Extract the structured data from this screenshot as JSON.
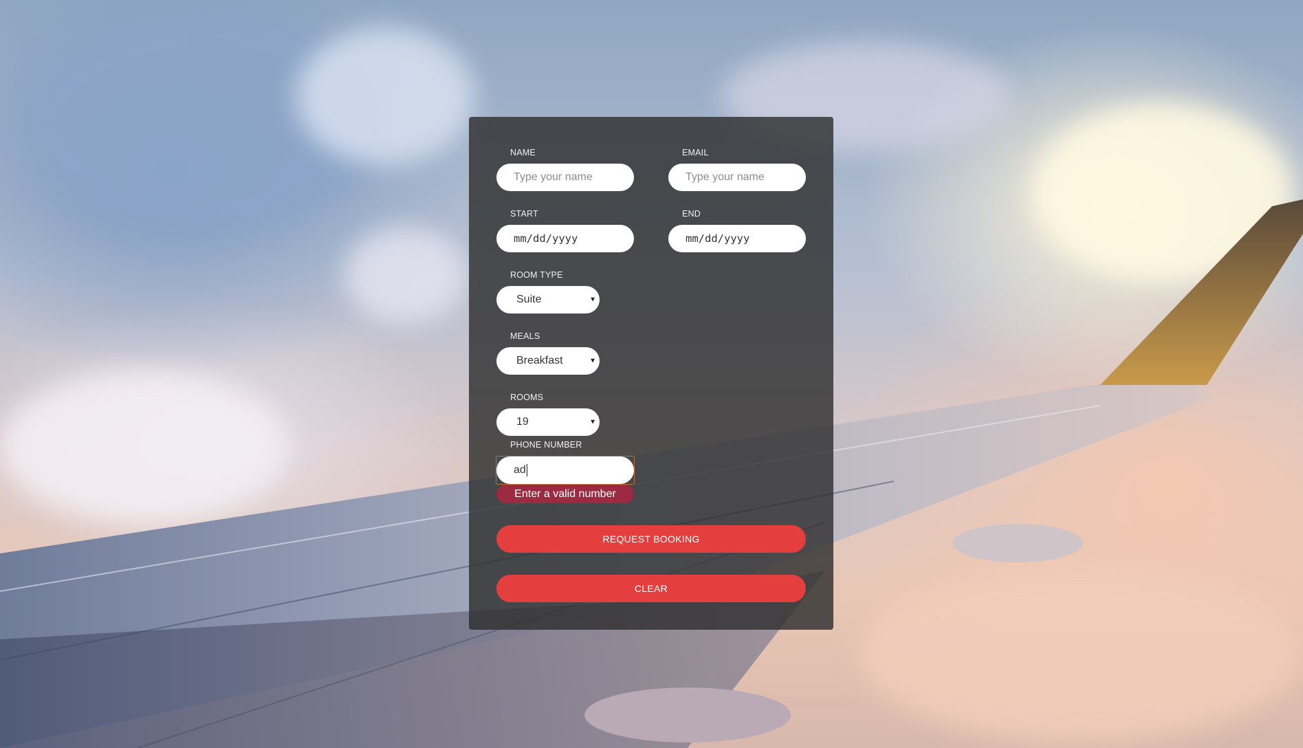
{
  "form": {
    "name": {
      "label": "NAME",
      "placeholder": "Type your name"
    },
    "email": {
      "label": "EMAIL",
      "placeholder": "Type your name"
    },
    "start": {
      "label": "START",
      "placeholder": "mm/dd/yyyy"
    },
    "end": {
      "label": "END",
      "placeholder": "mm/dd/yyyy"
    },
    "room_type": {
      "label": "ROOM TYPE",
      "value": "Suite"
    },
    "meals": {
      "label": "MEALS",
      "value": "Breakfast"
    },
    "rooms": {
      "label": "ROOMS",
      "value": "19"
    },
    "phone": {
      "label": "PHONE NUMBER",
      "value": "ad",
      "error": "Enter a valid number"
    },
    "request_label": "REQUEST BOOKING",
    "clear_label": "CLEAR"
  },
  "colors": {
    "accent": "#e53e3e",
    "error": "#9c2a40",
    "panel": "rgba(48,48,48,0.82)"
  },
  "icons": {
    "select_arrow": "triangle-down"
  }
}
